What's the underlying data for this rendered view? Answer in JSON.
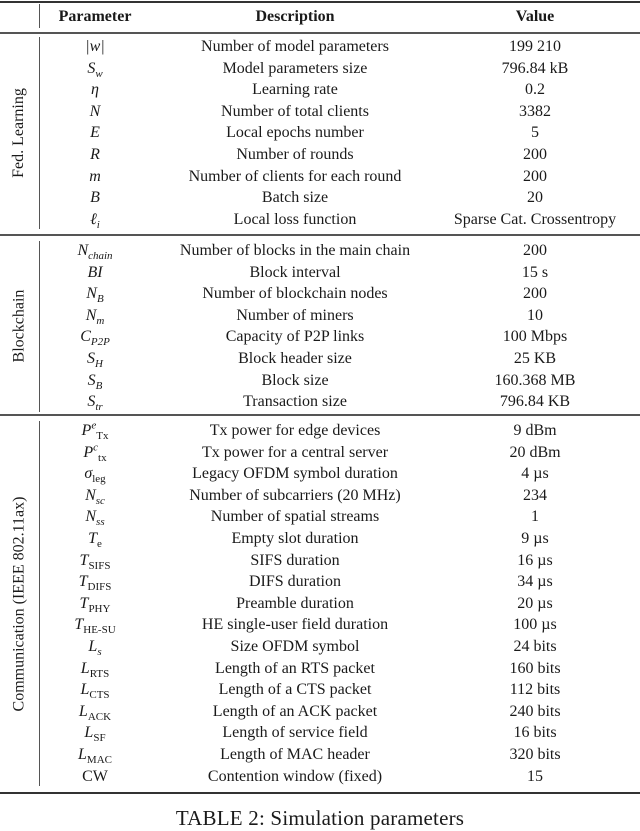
{
  "table": {
    "headers": {
      "parameter": "Parameter",
      "description": "Description",
      "value": "Value"
    },
    "groups": [
      {
        "label": "Fed. Learning",
        "rows": [
          {
            "param": "|w|",
            "param_base": "|w|",
            "param_sub": "",
            "param_sup": "",
            "description": "Number of model parameters",
            "value": "199 210"
          },
          {
            "param": "S_w",
            "param_base": "S",
            "param_sub": "w",
            "param_sup": "",
            "description": "Model parameters size",
            "value": "796.84 kB"
          },
          {
            "param": "η",
            "param_base": "η",
            "param_sub": "",
            "param_sup": "",
            "description": "Learning rate",
            "value": "0.2"
          },
          {
            "param": "N",
            "param_base": "N",
            "param_sub": "",
            "param_sup": "",
            "description": "Number of total clients",
            "value": "3382"
          },
          {
            "param": "E",
            "param_base": "E",
            "param_sub": "",
            "param_sup": "",
            "description": "Local epochs number",
            "value": "5"
          },
          {
            "param": "R",
            "param_base": "R",
            "param_sub": "",
            "param_sup": "",
            "description": "Number of rounds",
            "value": "200"
          },
          {
            "param": "m",
            "param_base": "m",
            "param_sub": "",
            "param_sup": "",
            "description": "Number of clients for each round",
            "value": "200"
          },
          {
            "param": "B",
            "param_base": "B",
            "param_sub": "",
            "param_sup": "",
            "description": "Batch size",
            "value": "20"
          },
          {
            "param": "ℓ_i",
            "param_base": "ℓ",
            "param_sub": "i",
            "param_sup": "",
            "description": "Local loss function",
            "value": "Sparse Cat. Crossentropy"
          }
        ]
      },
      {
        "label": "Blockchain",
        "rows": [
          {
            "param": "N_chain",
            "param_base": "N",
            "param_sub": "chain",
            "param_sup": "",
            "description": "Number of blocks in the main chain",
            "value": "200"
          },
          {
            "param": "BI",
            "param_base": "BI",
            "param_sub": "",
            "param_sup": "",
            "description": "Block interval",
            "value": "15 s"
          },
          {
            "param": "N_B",
            "param_base": "N",
            "param_sub": "B",
            "param_sup": "",
            "description": "Number of blockchain nodes",
            "value": "200"
          },
          {
            "param": "N_m",
            "param_base": "N",
            "param_sub": "m",
            "param_sup": "",
            "description": "Number of miners",
            "value": "10"
          },
          {
            "param": "C_P2P",
            "param_base": "C",
            "param_sub": "P2P",
            "param_sup": "",
            "description": "Capacity of P2P links",
            "value": "100 Mbps"
          },
          {
            "param": "S_H",
            "param_base": "S",
            "param_sub": "H",
            "param_sup": "",
            "description": "Block header size",
            "value": "25 KB"
          },
          {
            "param": "S_B",
            "param_base": "S",
            "param_sub": "B",
            "param_sup": "",
            "description": "Block size",
            "value": "160.368 MB"
          },
          {
            "param": "S_tr",
            "param_base": "S",
            "param_sub": "tr",
            "param_sup": "",
            "description": "Transaction size",
            "value": "796.84 KB"
          }
        ]
      },
      {
        "label": "Communication (IEEE 802.11ax)",
        "rows": [
          {
            "param": "P^e_Tx",
            "param_base": "P",
            "param_sub": "Tx",
            "param_sup": "e",
            "description": "Tx power for edge devices",
            "value": "9 dBm"
          },
          {
            "param": "P^c_tx",
            "param_base": "P",
            "param_sub": "tx",
            "param_sup": "c",
            "description": "Tx power for a central server",
            "value": "20 dBm"
          },
          {
            "param": "σ_leg",
            "param_base": "σ",
            "param_sub": "leg",
            "param_sup": "",
            "description": "Legacy OFDM symbol duration",
            "value": "4 µs"
          },
          {
            "param": "N_sc",
            "param_base": "N",
            "param_sub": "sc",
            "param_sup": "",
            "description": "Number of subcarriers (20 MHz)",
            "value": "234"
          },
          {
            "param": "N_ss",
            "param_base": "N",
            "param_sub": "ss",
            "param_sup": "",
            "description": "Number of spatial streams",
            "value": "1"
          },
          {
            "param": "T_e",
            "param_base": "T",
            "param_sub": "e",
            "param_sup": "",
            "description": "Empty slot duration",
            "value": "9 µs"
          },
          {
            "param": "T_SIFS",
            "param_base": "T",
            "param_sub": "SIFS",
            "param_sup": "",
            "description": "SIFS duration",
            "value": "16 µs"
          },
          {
            "param": "T_DIFS",
            "param_base": "T",
            "param_sub": "DIFS",
            "param_sup": "",
            "description": "DIFS duration",
            "value": "34 µs"
          },
          {
            "param": "T_PHY",
            "param_base": "T",
            "param_sub": "PHY",
            "param_sup": "",
            "description": "Preamble duration",
            "value": "20 µs"
          },
          {
            "param": "T_HE-SU",
            "param_base": "T",
            "param_sub": "HE-SU",
            "param_sup": "",
            "description": "HE single-user field duration",
            "value": "100 µs"
          },
          {
            "param": "L_s",
            "param_base": "L",
            "param_sub": "s",
            "param_sup": "",
            "description": "Size OFDM symbol",
            "value": "24 bits"
          },
          {
            "param": "L_RTS",
            "param_base": "L",
            "param_sub": "RTS",
            "param_sup": "",
            "description": "Length of an RTS packet",
            "value": "160 bits"
          },
          {
            "param": "L_CTS",
            "param_base": "L",
            "param_sub": "CTS",
            "param_sup": "",
            "description": "Length of a CTS packet",
            "value": "112 bits"
          },
          {
            "param": "L_ACK",
            "param_base": "L",
            "param_sub": "ACK",
            "param_sup": "",
            "description": "Length of an ACK packet",
            "value": "240 bits"
          },
          {
            "param": "L_SF",
            "param_base": "L",
            "param_sub": "SF",
            "param_sup": "",
            "description": "Length of service field",
            "value": "16 bits"
          },
          {
            "param": "L_MAC",
            "param_base": "L",
            "param_sub": "MAC",
            "param_sup": "",
            "description": "Length of MAC header",
            "value": "320 bits"
          },
          {
            "param": "CW",
            "param_base": "CW",
            "param_sub": "",
            "param_sup": "",
            "description": "Contention window (fixed)",
            "value": "15"
          }
        ]
      }
    ]
  },
  "caption": "TABLE 2: Simulation parameters"
}
